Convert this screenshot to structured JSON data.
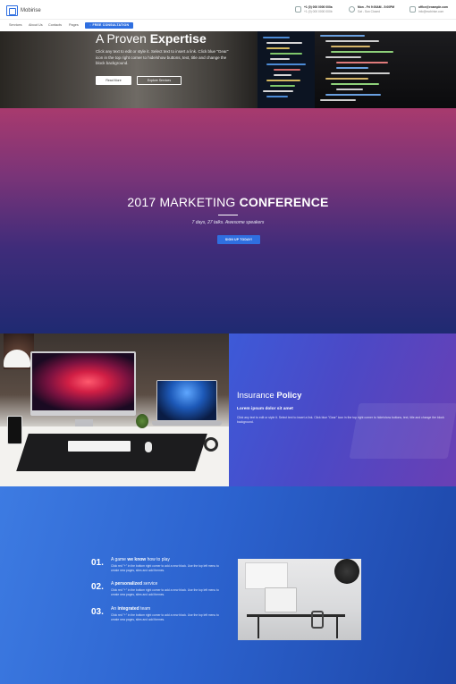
{
  "header": {
    "brand": "Mobirise",
    "contacts": [
      {
        "icon": "phone-icon",
        "line1": "+1 (0) 000 0000 000a",
        "line2": "+1 (0) 000 0000 000b"
      },
      {
        "icon": "clock-icon",
        "line1": "Mon - Fri 9:00AM - 5:00PM",
        "line2": "Sat - Sun Closed"
      },
      {
        "icon": "mail-icon",
        "line1": "office@example.com",
        "line2": "info@mobirise.com"
      }
    ]
  },
  "nav": {
    "items": [
      "Services",
      "About Us",
      "Contacts",
      "Pages"
    ],
    "cta": "FREE CONSULTATION"
  },
  "hero": {
    "title_light": "A Proven",
    "title_bold": "Expertise",
    "text": "Click any text to edit or style it. Select text to insert a link. Click blue \"Gear\" icon in the top right corner to hide/show buttons, text, title and change the block background.",
    "btn_primary": "Read More",
    "btn_secondary": "Explore Services"
  },
  "conference": {
    "title_light": "2017 MARKETING",
    "title_bold": "CONFERENCE",
    "subtitle": "7 days, 27 talks. Awesome speakers",
    "button": "SIGN UP TODAY!"
  },
  "insurance": {
    "title_light": "Insurance",
    "title_bold": "Policy",
    "subtitle": "Lorem ipsum dolor sit amet",
    "text": "Click any text to edit or style it. Select text to insert a link. Click blue \"Gear\" icon in the top right corner to hide/show buttons, text, title and change the block background."
  },
  "features": [
    {
      "num": "01.",
      "pre": "A game ",
      "bold": "we know",
      "post": " how to play",
      "text": "Click red \"+\" in the bottom right corner to add a new block. Use the top left menu to create new pages, sites and add themes."
    },
    {
      "num": "02.",
      "pre": "A ",
      "bold": "personalized",
      "post": " service",
      "text": "Click red \"+\" in the bottom right corner to add a new block. Use the top left menu to create new pages, sites and add themes."
    },
    {
      "num": "03.",
      "pre": "An ",
      "bold": "integrated",
      "post": " team",
      "text": "Click red \"+\" in the bottom right corner to add a new block. Use the top left menu to create new pages, sites and add themes."
    }
  ],
  "colors": {
    "accent": "#2f6fe0",
    "conference_top": "#a83a6e",
    "conference_bottom": "#1f2a72",
    "insurance_bg": "#4b49c6",
    "features_bg": "#2c63cf"
  }
}
